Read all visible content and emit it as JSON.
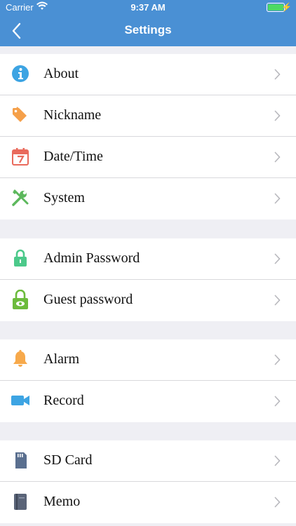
{
  "status": {
    "carrier": "Carrier",
    "time": "9:37 AM"
  },
  "nav": {
    "title": "Settings"
  },
  "groups": [
    {
      "items": [
        {
          "label": "About",
          "icon": "info-icon",
          "color": "#3da4e3"
        },
        {
          "label": "Nickname",
          "icon": "tag-icon",
          "color": "#f5a04a"
        },
        {
          "label": "Date/Time",
          "icon": "calendar-icon",
          "color": "#e96a5c"
        },
        {
          "label": "System",
          "icon": "tools-icon",
          "color": "#5cb85c"
        }
      ]
    },
    {
      "items": [
        {
          "label": "Admin Password",
          "icon": "lock-icon",
          "color": "#4cc98a"
        },
        {
          "label": "Guest password",
          "icon": "lock-eye-icon",
          "color": "#6cbb3c"
        }
      ]
    },
    {
      "items": [
        {
          "label": "Alarm",
          "icon": "bell-icon",
          "color": "#f7a94b"
        },
        {
          "label": "Record",
          "icon": "video-icon",
          "color": "#3da4e3"
        }
      ]
    },
    {
      "items": [
        {
          "label": "SD Card",
          "icon": "sd-card-icon",
          "color": "#5a6f8f"
        },
        {
          "label": "Memo",
          "icon": "memo-icon",
          "color": "#5a6478"
        }
      ]
    }
  ]
}
